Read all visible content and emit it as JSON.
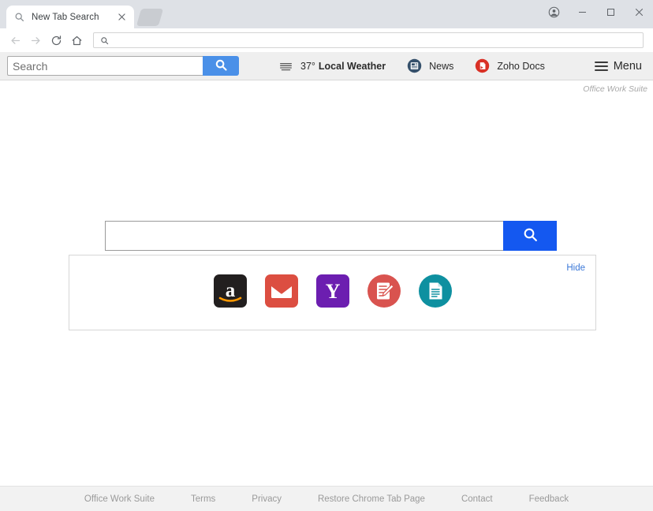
{
  "browser": {
    "tab": {
      "title": "New Tab Search",
      "favicon_icon": "search-icon",
      "close_icon": "close-icon"
    },
    "new_tab_button_icon": "new-tab-icon",
    "window_controls": {
      "profile_icon": "profile-icon",
      "minimize_icon": "minimize-icon",
      "maximize_icon": "maximize-icon",
      "close_icon": "close-icon"
    },
    "nav": {
      "back_icon": "back-arrow-icon",
      "forward_icon": "forward-arrow-icon",
      "reload_icon": "reload-icon",
      "home_icon": "home-icon",
      "omnibox_icon": "search-icon",
      "omnibox_value": "",
      "omnibox_placeholder": ""
    }
  },
  "extension_toolbar": {
    "search": {
      "value": "",
      "placeholder": "Search",
      "button_icon": "search-icon",
      "button_color": "#4a90e8"
    },
    "links": [
      {
        "temp": "37°",
        "label": "Local Weather",
        "icon": "weather-icon",
        "bold": true
      },
      {
        "temp": "",
        "label": "News",
        "icon": "news-icon",
        "bold": false
      },
      {
        "temp": "",
        "label": "Zoho Docs",
        "icon": "zoho-docs-icon",
        "bold": false
      }
    ],
    "menu": {
      "label": "Menu",
      "icon": "hamburger-menu-icon"
    }
  },
  "page": {
    "brand": "Office Work Suite",
    "search": {
      "value": "",
      "placeholder": "",
      "button_icon": "search-icon",
      "button_color": "#1458f0"
    },
    "shortcuts_panel": {
      "hide_label": "Hide",
      "shortcuts": [
        {
          "name": "amazon",
          "icon": "amazon-icon",
          "color": "#221f1f"
        },
        {
          "name": "gmail",
          "icon": "gmail-icon",
          "color": "#dc4e41"
        },
        {
          "name": "yahoo",
          "icon": "yahoo-icon",
          "color": "#6c1eb0"
        },
        {
          "name": "notepad",
          "icon": "red-notepad-icon",
          "color": "#d9534f"
        },
        {
          "name": "documents",
          "icon": "teal-document-icon",
          "color": "#0e90a0"
        }
      ]
    }
  },
  "footer": {
    "links": [
      "Office Work Suite",
      "Terms",
      "Privacy",
      "Restore Chrome Tab Page",
      "Contact",
      "Feedback"
    ]
  }
}
